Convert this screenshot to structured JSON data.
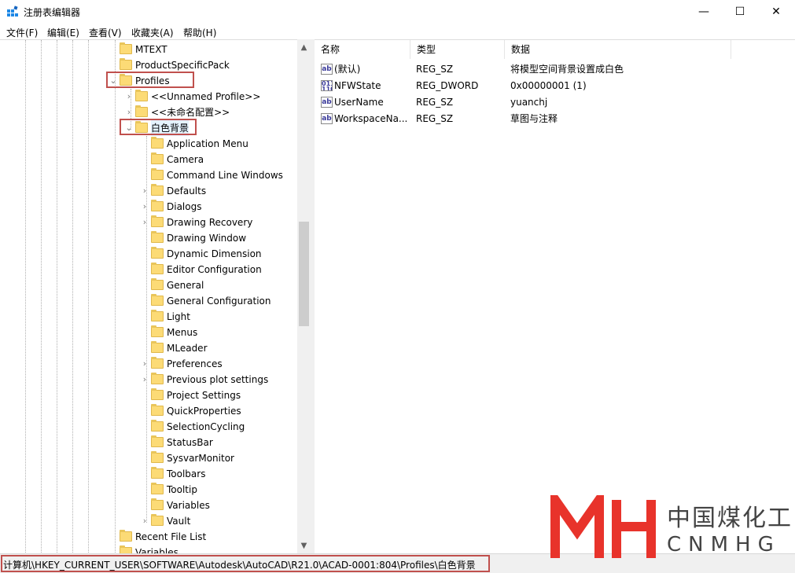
{
  "window": {
    "title": "注册表编辑器",
    "minimize": "—",
    "maximize": "☐",
    "close": "✕"
  },
  "menu": [
    "文件(F)",
    "编辑(E)",
    "查看(V)",
    "收藏夹(A)",
    "帮助(H)"
  ],
  "tree": {
    "top_nodes": [
      {
        "label": "MTEXT",
        "expander": ""
      },
      {
        "label": "ProductSpecificPack",
        "expander": ""
      },
      {
        "label": "Profiles",
        "expander": "⌄",
        "highlighted": true
      }
    ],
    "profile_children": [
      {
        "label": "<<Unnamed Profile>>",
        "expander": "›"
      },
      {
        "label": "<<未命名配置>>",
        "expander": "›"
      },
      {
        "label": "白色背景",
        "expander": "⌄",
        "highlighted": true
      }
    ],
    "profile_keys": [
      {
        "label": "Application Menu",
        "expander": ""
      },
      {
        "label": "Camera",
        "expander": ""
      },
      {
        "label": "Command Line Windows",
        "expander": ""
      },
      {
        "label": "Defaults",
        "expander": "›"
      },
      {
        "label": "Dialogs",
        "expander": "›"
      },
      {
        "label": "Drawing Recovery",
        "expander": "›"
      },
      {
        "label": "Drawing Window",
        "expander": ""
      },
      {
        "label": "Dynamic Dimension",
        "expander": ""
      },
      {
        "label": "Editor Configuration",
        "expander": ""
      },
      {
        "label": "General",
        "expander": ""
      },
      {
        "label": "General Configuration",
        "expander": ""
      },
      {
        "label": "Light",
        "expander": ""
      },
      {
        "label": "Menus",
        "expander": ""
      },
      {
        "label": "MLeader",
        "expander": ""
      },
      {
        "label": "Preferences",
        "expander": "›"
      },
      {
        "label": "Previous plot settings",
        "expander": "›"
      },
      {
        "label": "Project Settings",
        "expander": ""
      },
      {
        "label": "QuickProperties",
        "expander": ""
      },
      {
        "label": "SelectionCycling",
        "expander": ""
      },
      {
        "label": "StatusBar",
        "expander": ""
      },
      {
        "label": "SysvarMonitor",
        "expander": ""
      },
      {
        "label": "Toolbars",
        "expander": ""
      },
      {
        "label": "Tooltip",
        "expander": ""
      },
      {
        "label": "Variables",
        "expander": ""
      },
      {
        "label": "Vault",
        "expander": "›"
      }
    ],
    "bottom_nodes": [
      {
        "label": "Recent File List",
        "expander": ""
      },
      {
        "label": "Variables",
        "expander": ""
      }
    ]
  },
  "scrollbar": {
    "up": "▲",
    "down": "▼"
  },
  "values": {
    "headers": [
      "名称",
      "类型",
      "数据"
    ],
    "rows": [
      {
        "icon": "ab",
        "name": "(默认)",
        "type": "REG_SZ",
        "data": "将模型空间背景设置成白色"
      },
      {
        "icon": "011 110",
        "name": "NFWState",
        "type": "REG_DWORD",
        "data": "0x00000001 (1)"
      },
      {
        "icon": "ab",
        "name": "UserName",
        "type": "REG_SZ",
        "data": "yuanchj"
      },
      {
        "icon": "ab",
        "name": "WorkspaceNa...",
        "type": "REG_SZ",
        "data": "草图与注释"
      }
    ]
  },
  "status": {
    "path": "计算机\\HKEY_CURRENT_USER\\SOFTWARE\\Autodesk\\AutoCAD\\R21.0\\ACAD-0001:804\\Profiles\\白色背景"
  },
  "watermark": {
    "cn": "中国煤化工",
    "en": "CNMHG",
    "logo_color": "#e8332b"
  },
  "colors": {
    "highlight_box": "#c0504d",
    "folder": "#fcdb76"
  }
}
